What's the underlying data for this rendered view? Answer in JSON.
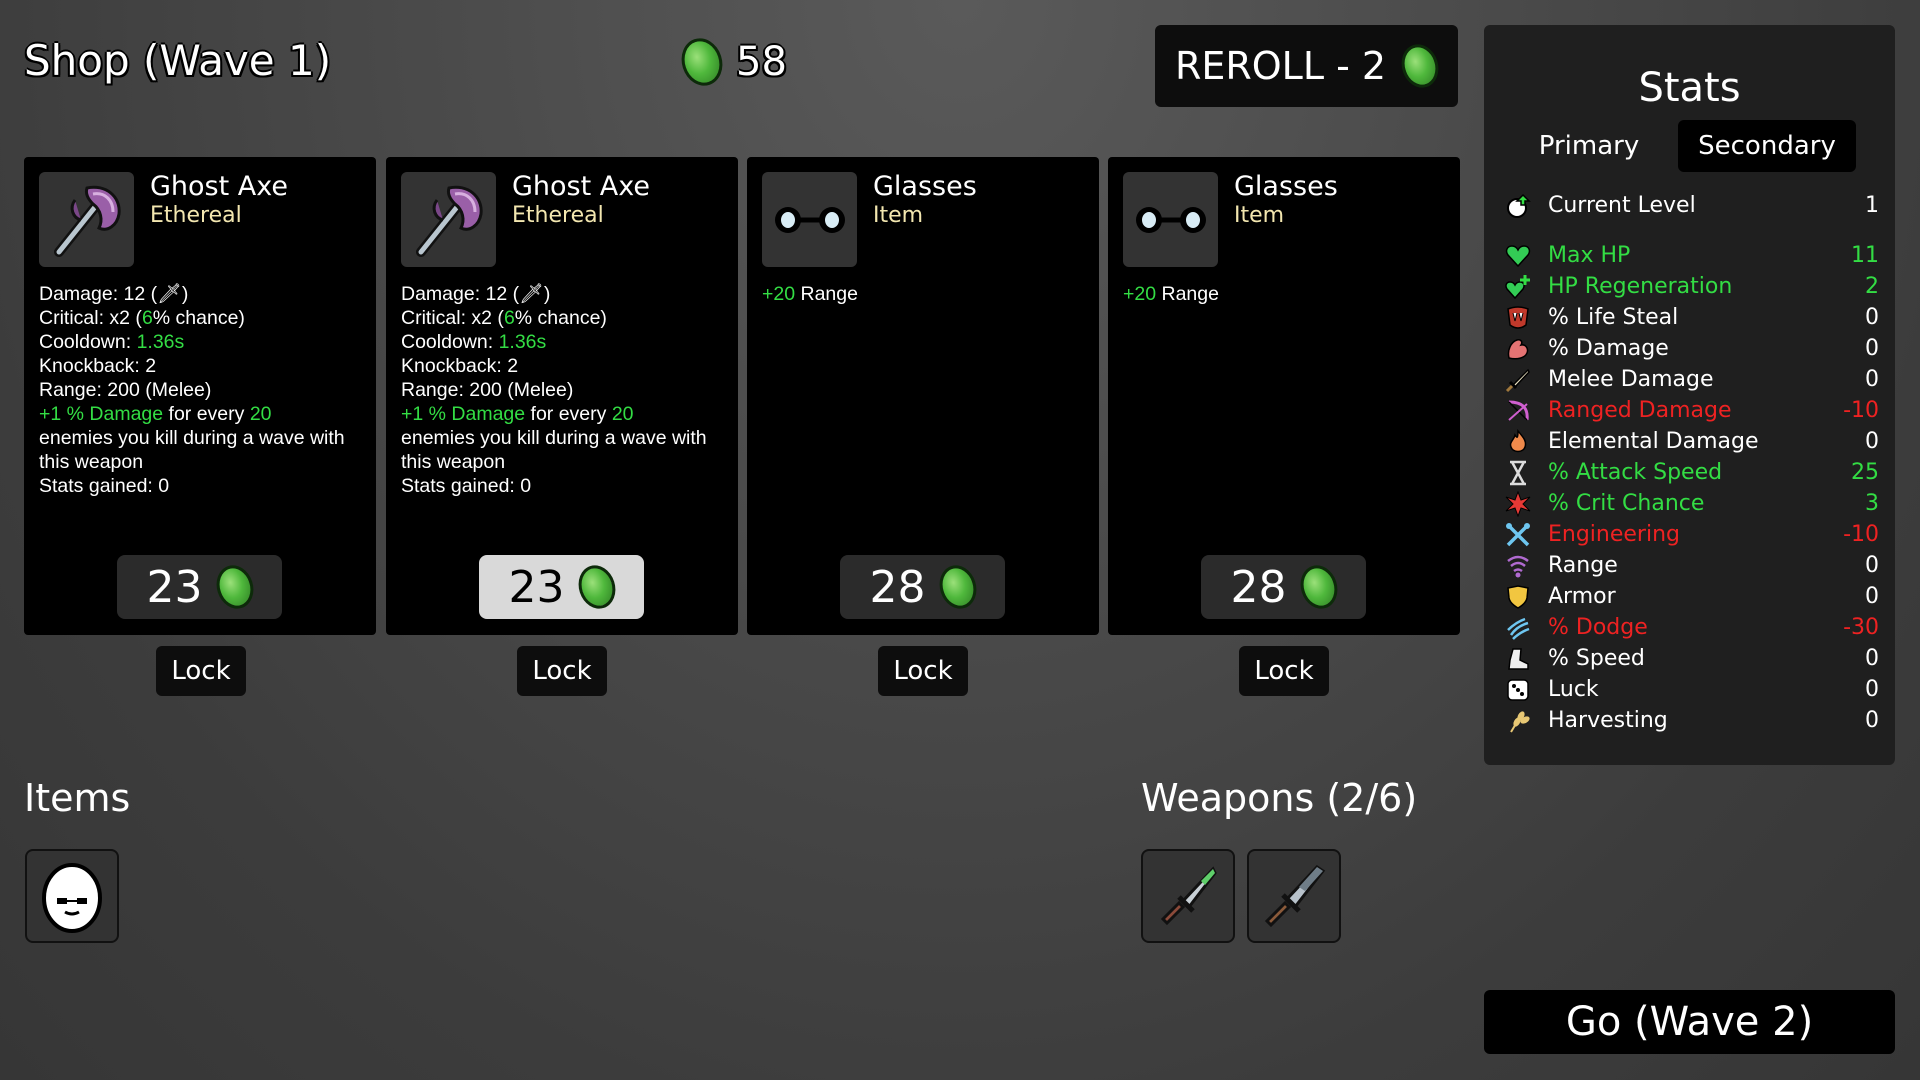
{
  "header": {
    "shop_title": "Shop (Wave 1)",
    "gold": "58",
    "reroll_label": "REROLL - 2"
  },
  "cards": [
    {
      "name": "Ghost Axe",
      "type": "Ethereal",
      "icon": "ghost-axe-icon",
      "desc": {
        "damage_label": "Damage: ",
        "damage_value": "12 (",
        "damage_end": ")",
        "critical_label": "Critical: ",
        "critical_mult": "x2 (",
        "critical_pct": "6",
        "critical_end": "% chance)",
        "cooldown_label": "Cooldown: ",
        "cooldown_value": "1.36s",
        "knockback": "Knockback: 2",
        "range": "Range: 200 (Melee)",
        "bonus_amount": "+1 % Damage",
        "bonus_mid": " for every ",
        "bonus_count": "20",
        "bonus_rest": "enemies you kill during a wave with this weapon",
        "stats_gained": "Stats gained: 0"
      },
      "price": "23",
      "lock_label": "Lock"
    },
    {
      "name": "Ghost Axe",
      "type": "Ethereal",
      "icon": "ghost-axe-icon",
      "desc": {
        "damage_label": "Damage: ",
        "damage_value": "12 (",
        "damage_end": ")",
        "critical_label": "Critical: ",
        "critical_mult": "x2 (",
        "critical_pct": "6",
        "critical_end": "% chance)",
        "cooldown_label": "Cooldown: ",
        "cooldown_value": "1.36s",
        "knockback": "Knockback: 2",
        "range": "Range: 200 (Melee)",
        "bonus_amount": "+1 % Damage",
        "bonus_mid": " for every ",
        "bonus_count": "20",
        "bonus_rest": "enemies you kill during a wave with this weapon",
        "stats_gained": "Stats gained: 0"
      },
      "price": "23",
      "lock_label": "Lock"
    },
    {
      "name": "Glasses",
      "type": "Item",
      "icon": "glasses-icon",
      "desc": {
        "amount": "+20",
        "stat": " Range"
      },
      "price": "28",
      "lock_label": "Lock"
    },
    {
      "name": "Glasses",
      "type": "Item",
      "icon": "glasses-icon",
      "desc": {
        "amount": "+20",
        "stat": " Range"
      },
      "price": "28",
      "lock_label": "Lock"
    }
  ],
  "items_section": {
    "title": "Items",
    "items": [
      {
        "icon": "egg-character-icon"
      }
    ]
  },
  "weapons_section": {
    "title": "Weapons (2/6)",
    "weapons": [
      {
        "icon": "knife-icon"
      },
      {
        "icon": "knife-icon"
      }
    ]
  },
  "stats": {
    "title": "Stats",
    "tabs": {
      "primary": "Primary",
      "secondary": "Secondary",
      "active": "secondary"
    },
    "rows": [
      {
        "label": "Current Level",
        "value": "1",
        "color": "white",
        "icon": "level-up-icon"
      },
      {
        "label": "Max HP",
        "value": "11",
        "color": "green",
        "icon": "heart-icon"
      },
      {
        "label": "HP Regeneration",
        "value": "2",
        "color": "green",
        "icon": "heart-plus-icon"
      },
      {
        "label": "% Life Steal",
        "value": "0",
        "color": "white",
        "icon": "fangs-icon"
      },
      {
        "label": "% Damage",
        "value": "0",
        "color": "white",
        "icon": "muscle-icon"
      },
      {
        "label": "Melee Damage",
        "value": "0",
        "color": "white",
        "icon": "sword-icon"
      },
      {
        "label": "Ranged Damage",
        "value": "-10",
        "color": "red",
        "icon": "bow-icon"
      },
      {
        "label": "Elemental Damage",
        "value": "0",
        "color": "white",
        "icon": "flame-icon"
      },
      {
        "label": "% Attack Speed",
        "value": "25",
        "color": "green",
        "icon": "hourglass-icon"
      },
      {
        "label": "% Crit Chance",
        "value": "3",
        "color": "green",
        "icon": "crit-burst-icon"
      },
      {
        "label": "Engineering",
        "value": "-10",
        "color": "red",
        "icon": "wrench-cross-icon"
      },
      {
        "label": "Range",
        "value": "0",
        "color": "white",
        "icon": "range-waves-icon"
      },
      {
        "label": "Armor",
        "value": "0",
        "color": "white",
        "icon": "shield-icon"
      },
      {
        "label": "% Dodge",
        "value": "-30",
        "color": "red",
        "icon": "dodge-icon"
      },
      {
        "label": "% Speed",
        "value": "0",
        "color": "white",
        "icon": "boot-icon"
      },
      {
        "label": "Luck",
        "value": "0",
        "color": "white",
        "icon": "dice-icon"
      },
      {
        "label": "Harvesting",
        "value": "0",
        "color": "white",
        "icon": "wheat-icon"
      }
    ]
  },
  "go_button": "Go (Wave 2)",
  "colors": {
    "stat_green": "#33dd44",
    "stat_red": "#ee2222",
    "coin": "#4fb83c"
  }
}
